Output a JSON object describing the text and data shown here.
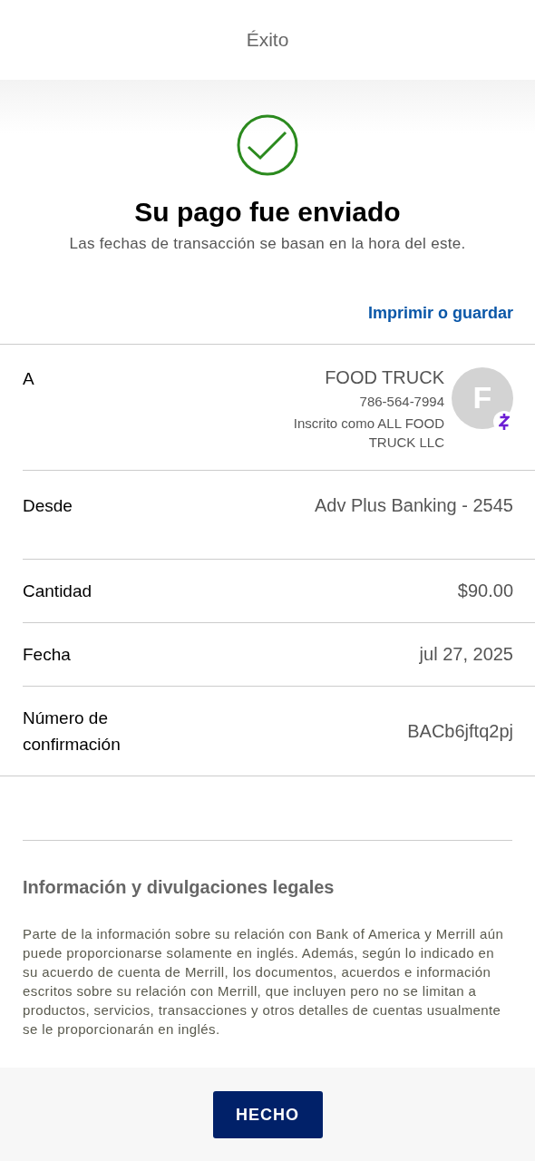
{
  "header": {
    "title": "Éxito"
  },
  "status": {
    "title": "Su pago fue enviado",
    "subtitle": "Las fechas de transacción se basan en la hora del este."
  },
  "print_link": "Imprimir o guardar",
  "details": [
    {
      "kind": "recipient",
      "label": "A",
      "name": "FOOD TRUCK",
      "phone": "786-564-7994",
      "enrolled": "Inscrito como ALL FOOD TRUCK LLC",
      "avatar_letter": "F"
    },
    {
      "kind": "plain",
      "label": "Desde",
      "value": "Adv Plus Banking - 2545",
      "tall": true
    },
    {
      "kind": "plain",
      "label": "Cantidad",
      "value": "$90.00",
      "tall": false
    },
    {
      "kind": "plain",
      "label": "Fecha",
      "value": "jul 27, 2025",
      "tall": false
    },
    {
      "kind": "plain",
      "label": "Número de confirmación",
      "value": "BACb6jftq2pj",
      "tall": false
    }
  ],
  "legal": {
    "title": "Información y divulgaciones legales",
    "text": "Parte de la información sobre su relación con Bank of America y Merrill aún puede proporcionarse solamente en inglés. Además, según lo indicado en su acuerdo de cuenta de Merrill, los documentos, acuerdos e información escritos sobre su relación con Merrill, que incluyen pero no se limitan a productos, servicios, transacciones y otros detalles de cuentas usualmente se le proporcionarán en inglés."
  },
  "done_button": "HECHO"
}
